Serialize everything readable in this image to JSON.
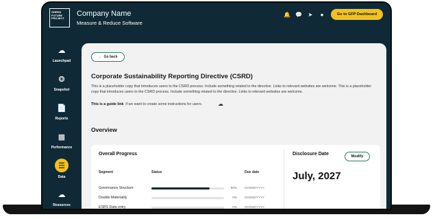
{
  "header": {
    "logo_text": "GREEN FUTURE PROJECT",
    "company_name": "Company Name",
    "tagline": "Measure & Reduce Software",
    "dashboard_button": "Go to GFP Dashboard"
  },
  "sidebar": {
    "items": [
      {
        "label": "Launchpad",
        "icon": "launchpad-icon",
        "active": false
      },
      {
        "label": "Snapshot",
        "icon": "snapshot-icon",
        "active": false
      },
      {
        "label": "Reports",
        "icon": "reports-icon",
        "active": false
      },
      {
        "label": "Performance",
        "icon": "performance-icon",
        "active": false
      },
      {
        "label": "Data",
        "icon": "data-icon",
        "active": true
      },
      {
        "label": "Resources",
        "icon": "resources-icon",
        "active": false
      }
    ]
  },
  "main": {
    "back_label": "Go back",
    "title": "Corporate Sustainability Reporting Directive (CSRD)",
    "description": "This is a placeholder copy that introduces users to the CSRD process. Include something related to the directive. Links to relevant websites are welcome. This is a placeholder copy that introduces users to the CSRD process. Include something related to the directive. Links to relevant websites are welcome.",
    "guide_link": "This is a guide link",
    "guide_text": "if we want to  create some instructions for users.",
    "overview_title": "Overview"
  },
  "progress": {
    "title": "Overall Progress",
    "headers": {
      "segment": "Segment",
      "status": "Status",
      "due": "Due date"
    },
    "rows": [
      {
        "segment": "Governance Structure",
        "progress": 0.8,
        "percent": "80%",
        "due": "DD/MM/YYYY"
      },
      {
        "segment": "Double Materiality",
        "progress": 0.0,
        "percent": "0%",
        "due": "DD/MM/YYYY"
      },
      {
        "segment": "ESRS Data entry",
        "progress": 0.0,
        "percent": "0%",
        "due": "DD/MM/YYYY"
      }
    ]
  },
  "disclosure": {
    "title": "Disclosure Date",
    "modify_label": "Modify",
    "date": "July, 2027"
  },
  "colors": {
    "accent": "#f4c21b",
    "brand_dark": "#0f2a36",
    "outline_green": "#2e7d61"
  }
}
